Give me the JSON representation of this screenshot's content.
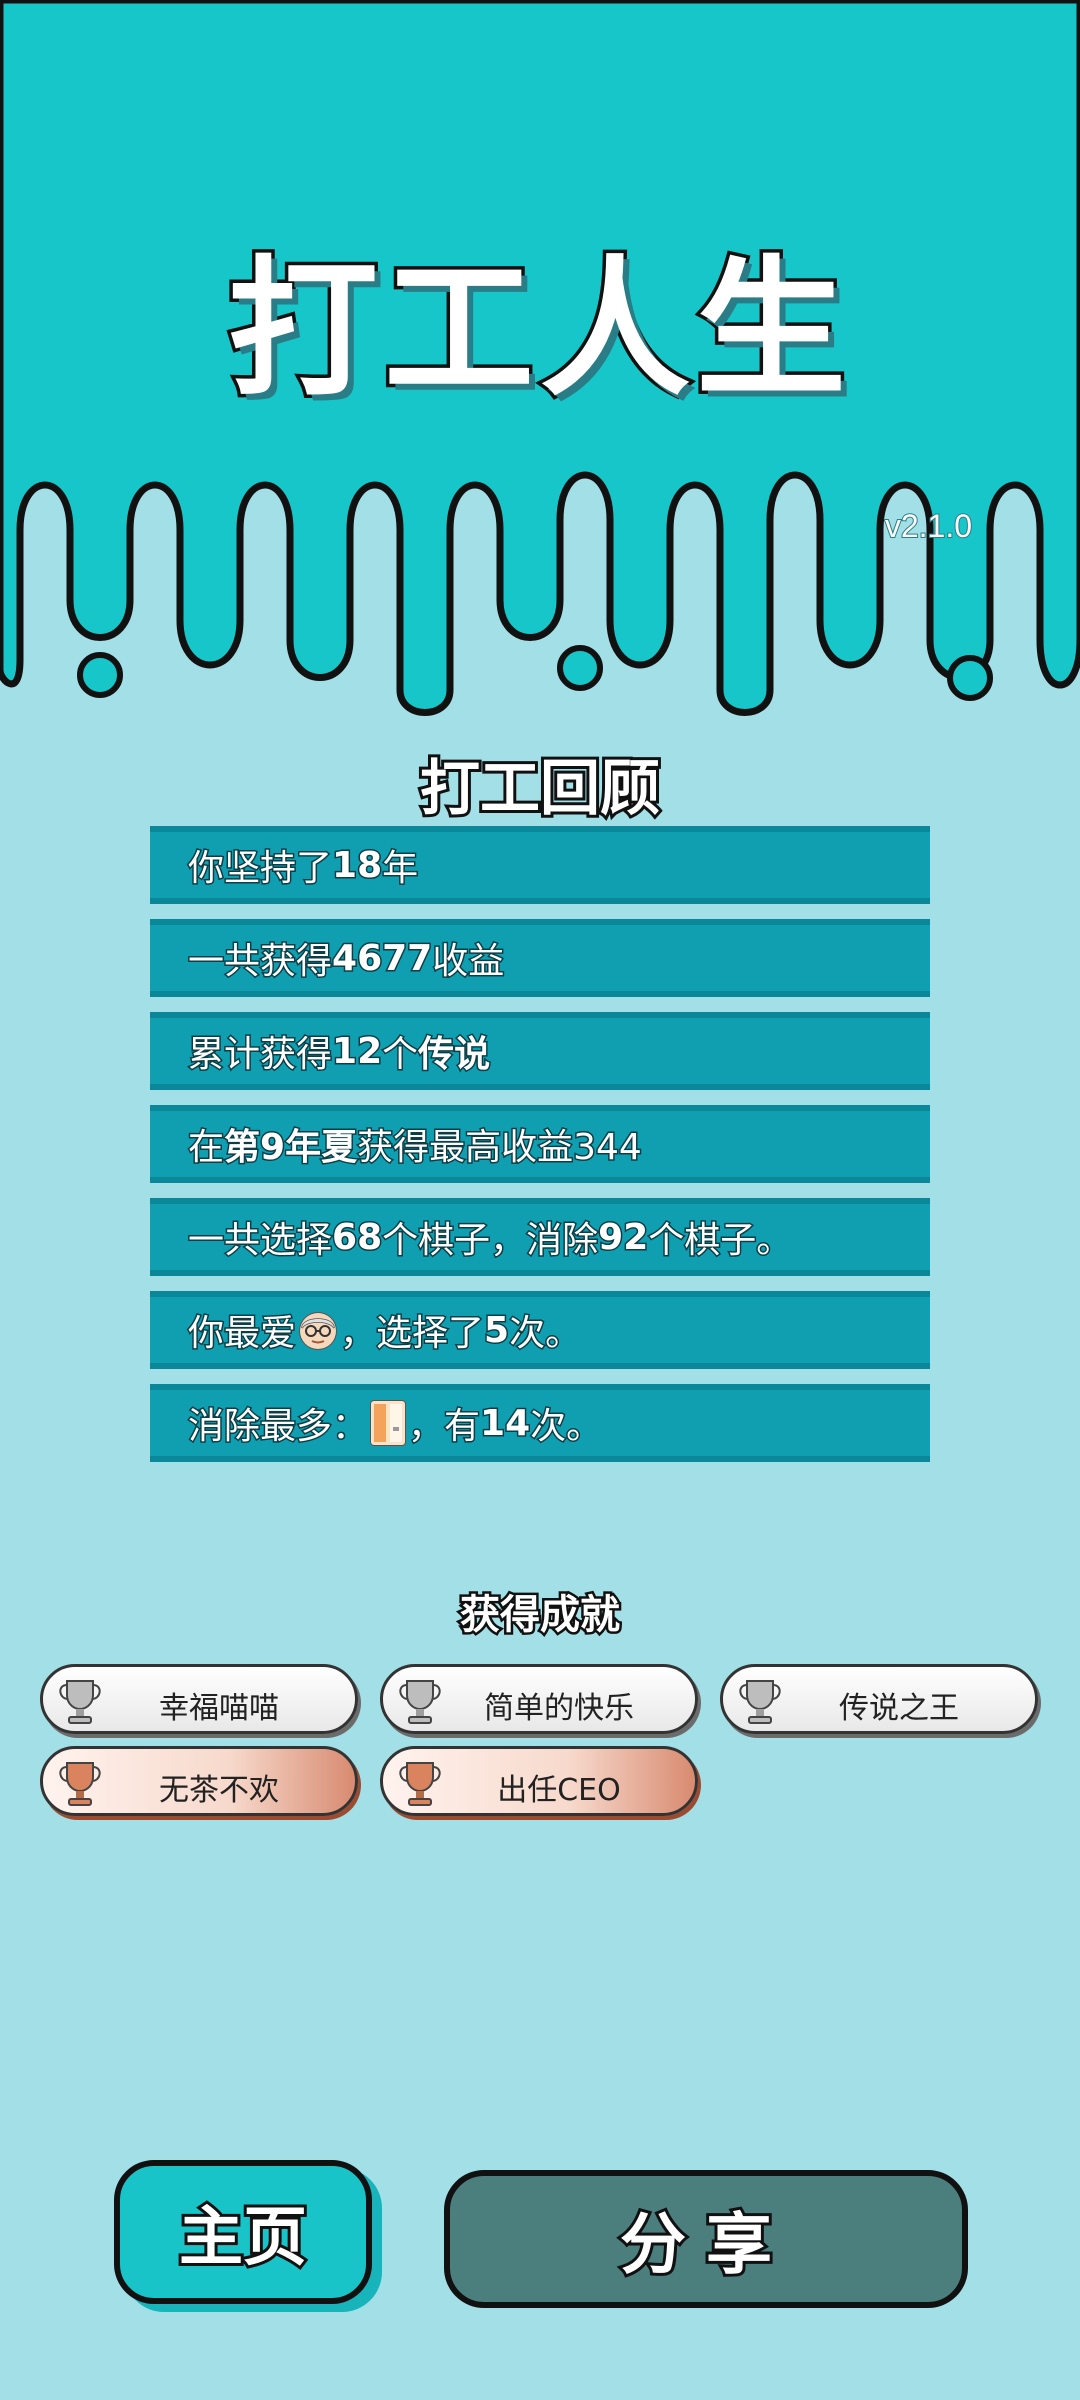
{
  "app": {
    "title": "打工人生",
    "version": "v2.1.0"
  },
  "review": {
    "title": "打工回顾",
    "rows": [
      {
        "p1": "你坚持了",
        "b1": "18",
        "p2": "年"
      },
      {
        "p1": "一共获得",
        "b1": "4677",
        "p2": "收益"
      },
      {
        "p1": "累计获得",
        "b1": "12",
        "p2": "个",
        "b2": "传说"
      },
      {
        "p1": "在 ",
        "b1": "第9年夏",
        "p2": " 获得最高收益344"
      },
      {
        "p1": "一共选择",
        "b1": "68",
        "p2": "个棋子，消除",
        "b2": "92",
        "p3": "个棋子。"
      },
      {
        "p1": "你最爱",
        "p2": "，选择了",
        "b2": "5",
        "p3": "次。",
        "icon": "grandpa-icon"
      },
      {
        "p1": "消除最多：",
        "p2": "，有",
        "b2": "14",
        "p3": "次。",
        "icon": "door-icon"
      }
    ]
  },
  "achievements": {
    "title": "获得成就",
    "items": [
      {
        "label": "幸福喵喵",
        "tier": "silver"
      },
      {
        "label": "简单的快乐",
        "tier": "silver"
      },
      {
        "label": "传说之王",
        "tier": "silver"
      },
      {
        "label": "无茶不欢",
        "tier": "bronze"
      },
      {
        "label": "出任CEO",
        "tier": "bronze"
      }
    ]
  },
  "buttons": {
    "home": "主页",
    "share": "分享"
  },
  "colors": {
    "top_bg": "#17c6c9",
    "page_bg": "#a3dfe6",
    "row_bg": "#0f9fb1",
    "share_bg": "#4a7f7d"
  }
}
